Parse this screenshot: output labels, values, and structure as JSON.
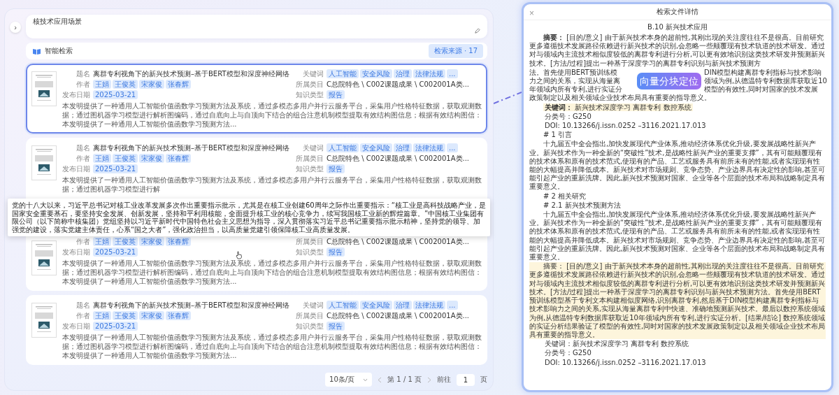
{
  "sidebar_toggle": "›",
  "query": {
    "value": "核技术应用场景"
  },
  "results": {
    "title": "智能检索",
    "source_button": "检索来源 · 17",
    "cards": [
      {
        "selected": true,
        "title": {
          "label": "题名",
          "value": "离群专利视角下的新兴技术预测–基于BERT模型和深度神经网络"
        },
        "authors": {
          "label": "作者",
          "tags": [
            "王娟",
            "王俊英",
            "宋家俊",
            "张春辉"
          ]
        },
        "date": {
          "label": "发布日期",
          "value": "2025-03-21"
        },
        "keywords": {
          "label": "关键词",
          "tags": [
            "人工智能",
            "安全风险",
            "治理",
            "法律法规",
            "..."
          ]
        },
        "category": {
          "label": "所属类目",
          "value": "C总院特色 \\ C002课题成果 \\ C002001A类..."
        },
        "type": {
          "label": "知识类型",
          "value": "报告"
        },
        "abstract": "本发明提供了一种通用人工智能价值函数学习预测方法及系统，通过多模态多用户并行云服务平台，采集用户性格特征数据，获取观测数据；通过图机器学习模型进行解析图编码，通过自底向上与自顶向下结合的组合注意机制模型提取有效结构图信息；根据有效结构图信：本发明提供了一种通用人工智能价值函数学习预测方法..."
      },
      {
        "selected": false,
        "title": {
          "label": "题名",
          "value": "离群专利视角下的新兴技术预测–基于BERT模型和深度神经网络"
        },
        "authors": {
          "label": "作者",
          "tags": [
            "王娟",
            "王俊英",
            "宋家俊",
            "张春辉"
          ]
        },
        "date": {
          "label": "发布日期",
          "value": "2025-03-21"
        },
        "keywords": {
          "label": "关键词",
          "tags": [
            "人工智能",
            "安全风险",
            "治理",
            "法律法规",
            "..."
          ]
        },
        "category": {
          "label": "所属类目",
          "value": "C总院特色 \\ C002课题成果 \\ C002001A类..."
        },
        "type": {
          "label": "知识类型",
          "value": "报告"
        },
        "abstract": "本发明提供了一种通用人工智能价值函数学习预测方法及系统，通过多模态多用户并行云服务平台，采集用户性格特征数据，获取观测数据；通过图机器学习模型进行解"
      },
      {
        "selected": false,
        "authors": {
          "label": "作者",
          "tags": [
            "王娟",
            "王俊英",
            "宋家俊",
            "张春辉"
          ]
        },
        "date": {
          "label": "发布日期",
          "value": "2025-03-21"
        },
        "category": {
          "label": "所属类目",
          "value": "C总院特色 \\ C002课题成果 \\ C002001A类..."
        },
        "type": {
          "label": "知识类型",
          "value": "报告"
        },
        "abstract": "本发明提供了一种通用人工智能价值函数学习预测方法及系统，通过多模态多用户并行云服务平台，采集用户性格特征数据，获取观测数据；通过图机器学习模型进行解析图编码，通过自底向上与自顶向下结合的组合注意机制模型提取有效结构图信息；根据有效结构图信：本发明提供了一种通用人工智能价值函数学习预测方法..."
      },
      {
        "selected": false,
        "title": {
          "label": "题名",
          "value": "离群专利视角下的新兴技术预测–基于BERT模型和深度神经网络"
        },
        "authors": {
          "label": "作者",
          "tags": [
            "王娟",
            "王俊英",
            "宋家俊",
            "张春辉"
          ]
        },
        "date": {
          "label": "发布日期",
          "value": "2025-03-21"
        },
        "keywords": {
          "label": "关键词",
          "tags": [
            "人工智能",
            "安全风险",
            "治理",
            "法律法规",
            "..."
          ]
        },
        "category": {
          "label": "所属类目",
          "value": "C总院特色 \\ C002课题成果 \\ C002001A类..."
        },
        "type": {
          "label": "知识类型",
          "value": "报告"
        },
        "abstract": "本发明提供了一种通用人工智能价值函数学习预测方法及系统，通过多模态多用户并行云服务平台，采集用户性格特征数据，获取观测数据；通过图机器学习模型进行解析图编码，通过自底向上与自顶向下结合的组合注意机制模型提取有效结构图信息；根据有效结构图信：本发明提供了一种通用人工智能价值函数学习预测方法..."
      }
    ],
    "tooltip": "党的十八大以来，习近平总书记对核工业改革发展多次作出重要指示批示，尤其是在核工业创建60周年之际作出重要指示：“核工业是高科技战略产业，是国家安全重要基石，要坚持安全发展、创新发展，坚持和平利用核能，全面提升核工业的核心竞争力，续写我国核工业新的辉煌篇章。”中国核工业集团有限公司（以下简称中核集团）党组坚持以习近平新时代中国特色社会主义思想为指导，深入贯彻落实习近平总书记重要指示批示精神，坚持党的领导、加强党的建设，落实党建主体责任，心系“国之大者”，强化政治担当，以高质量党建引领保障核工业高质量发展。"
  },
  "pagination": {
    "page_size": "10条/页",
    "page_info": "第 1 / 1 页",
    "goto_label": "前往",
    "goto_value": "1",
    "goto_suffix": "页"
  },
  "detail": {
    "close": "×",
    "title": "检索文件详情",
    "doc_title": "B.10 新兴技术应用",
    "blocks": [
      {
        "kind": "split",
        "before": "**摘要：** [目的/意义] 由于新兴技术本身的超前性,其刚出现的关注度往往不是很高。目前研究更多遵循技术发展路径依赖进行新兴技术的识别,会忽略一些颠覆现有技术轨道的技术研发。通过对与领域内主流技术相似度较低的离群专利进行分析,可以更有效地识别这类技术研发并预测新兴技术。[方法/过程]提出一种基于深度学习的离群专利识别与新兴技术预测方",
        "left": [
          "法。首先使用BERT预训练模",
          "力之间的关系，实现从海量离",
          "年领域内所有专利,进行实证分"
        ],
        "badge": "向量分块定位",
        "right": [
          "DIN模型构建离群专利指标与技术影响",
          "领域为例,从德温特专利数据库获取近10",
          "模型的有效性,同时对国家的技术发展"
        ],
        "after": "政策制定以及相关领域企业技术布局具有重要的指导意义。",
        "highlighted": false
      },
      {
        "kind": "meta",
        "text": "**关键词：** 新兴技术深度学习 离群专利  数控系统",
        "highlighted": true
      },
      {
        "kind": "meta",
        "text": "分类号：G250",
        "highlighted": false
      },
      {
        "kind": "meta",
        "text": "DOI: 10.13266/j.issn.0252 –3116.2021.17.013",
        "highlighted": false
      },
      {
        "kind": "heading",
        "text": "# 1 引言"
      },
      {
        "kind": "paragraph",
        "text": "十九届五中全会指出,加快发展现代产业体系,推动经济体系优化升级,要发展战略性新兴产业。新兴技术作为一种全新的“突破性”技术,是战略性新兴产业的重要支撑”，其有可能颠覆现有的技术体系和原有的技术范式,使现有的产品、工艺或服务具有前所未有的性能,或者实现现有性能的大幅提高并降低成本。新兴技术对市场规则、竞争态势、产业边界具有决定性的影响,甚至可能引起产业的重新洗牌。因此,新兴技术预测对国家、企业等各个层面的技术布局和战略制定具有重要意义。",
        "highlighted": false
      },
      {
        "kind": "heading",
        "text": "# 2 相关研究"
      },
      {
        "kind": "heading",
        "text": "# 2.1 新兴技术预测方法"
      },
      {
        "kind": "paragraph",
        "text": "十九届五中全会指出,加快发展现代产业体系,推动经济体系优化升级,要发展战略性新兴产业。新兴技术作为一种全新的“突破性”技术,是战略性新兴产业的重要支撑”，其有可能颠覆现有的技术体系和原有的技术范式,使现有的产品、工艺或服务具有前所未有的性能,或者实现现有性能的大幅提高并降低成本。新兴技术对市场规则、竞争态势、产业边界具有决定性的影响,甚至可能引起产业的重新洗牌。因此,新兴技术预测对国家、企业等各个层面的技术布局和战略制定具有重要意义。",
        "highlighted": false
      },
      {
        "kind": "paragraph",
        "text": "摘要： [目的/意义] 由于新兴技术本身的超前性,其刚出现的关注度往往不是很高。目前研究更多遵循技术发展路径依赖进行新兴技术的识别,会忽略一些颠覆现有技术轨道的技术研发。通过对与领域内主流技术相似度较低的离群专利进行分析,可以更有效地识别这类技术研发并预测新兴技术。[方法/过程]提出一种基于深度学习的离群专利识别与新兴技术预测方法。首先使用BERT预训练模型基于专利文本构建相似度网络,识别离群专利,然后基于DIN模型构建离群专利指标与技术影响力之间的关系,实现从海量离群专利中快速、准确地预测新兴技术。最后以数控系统领域为例,从德温特专利数据库获取近10年领域内所有专利,进行实证分析。[结果/结论] 数控系统领域的实证分析结果验证了模型的有效性,同时对国家的技术发展政策制定以及相关领域企业技术布局具有重要的指导意义。",
        "highlighted": true
      },
      {
        "kind": "meta",
        "text": "关键词：新兴技术深度学习 离群专利  数控系统",
        "highlighted": false
      },
      {
        "kind": "meta",
        "text": "分类号：G250",
        "highlighted": false
      },
      {
        "kind": "meta",
        "text": "DOI: 10.13266/j.issn.0252 –3116.2021.17.013",
        "highlighted": false
      }
    ]
  }
}
